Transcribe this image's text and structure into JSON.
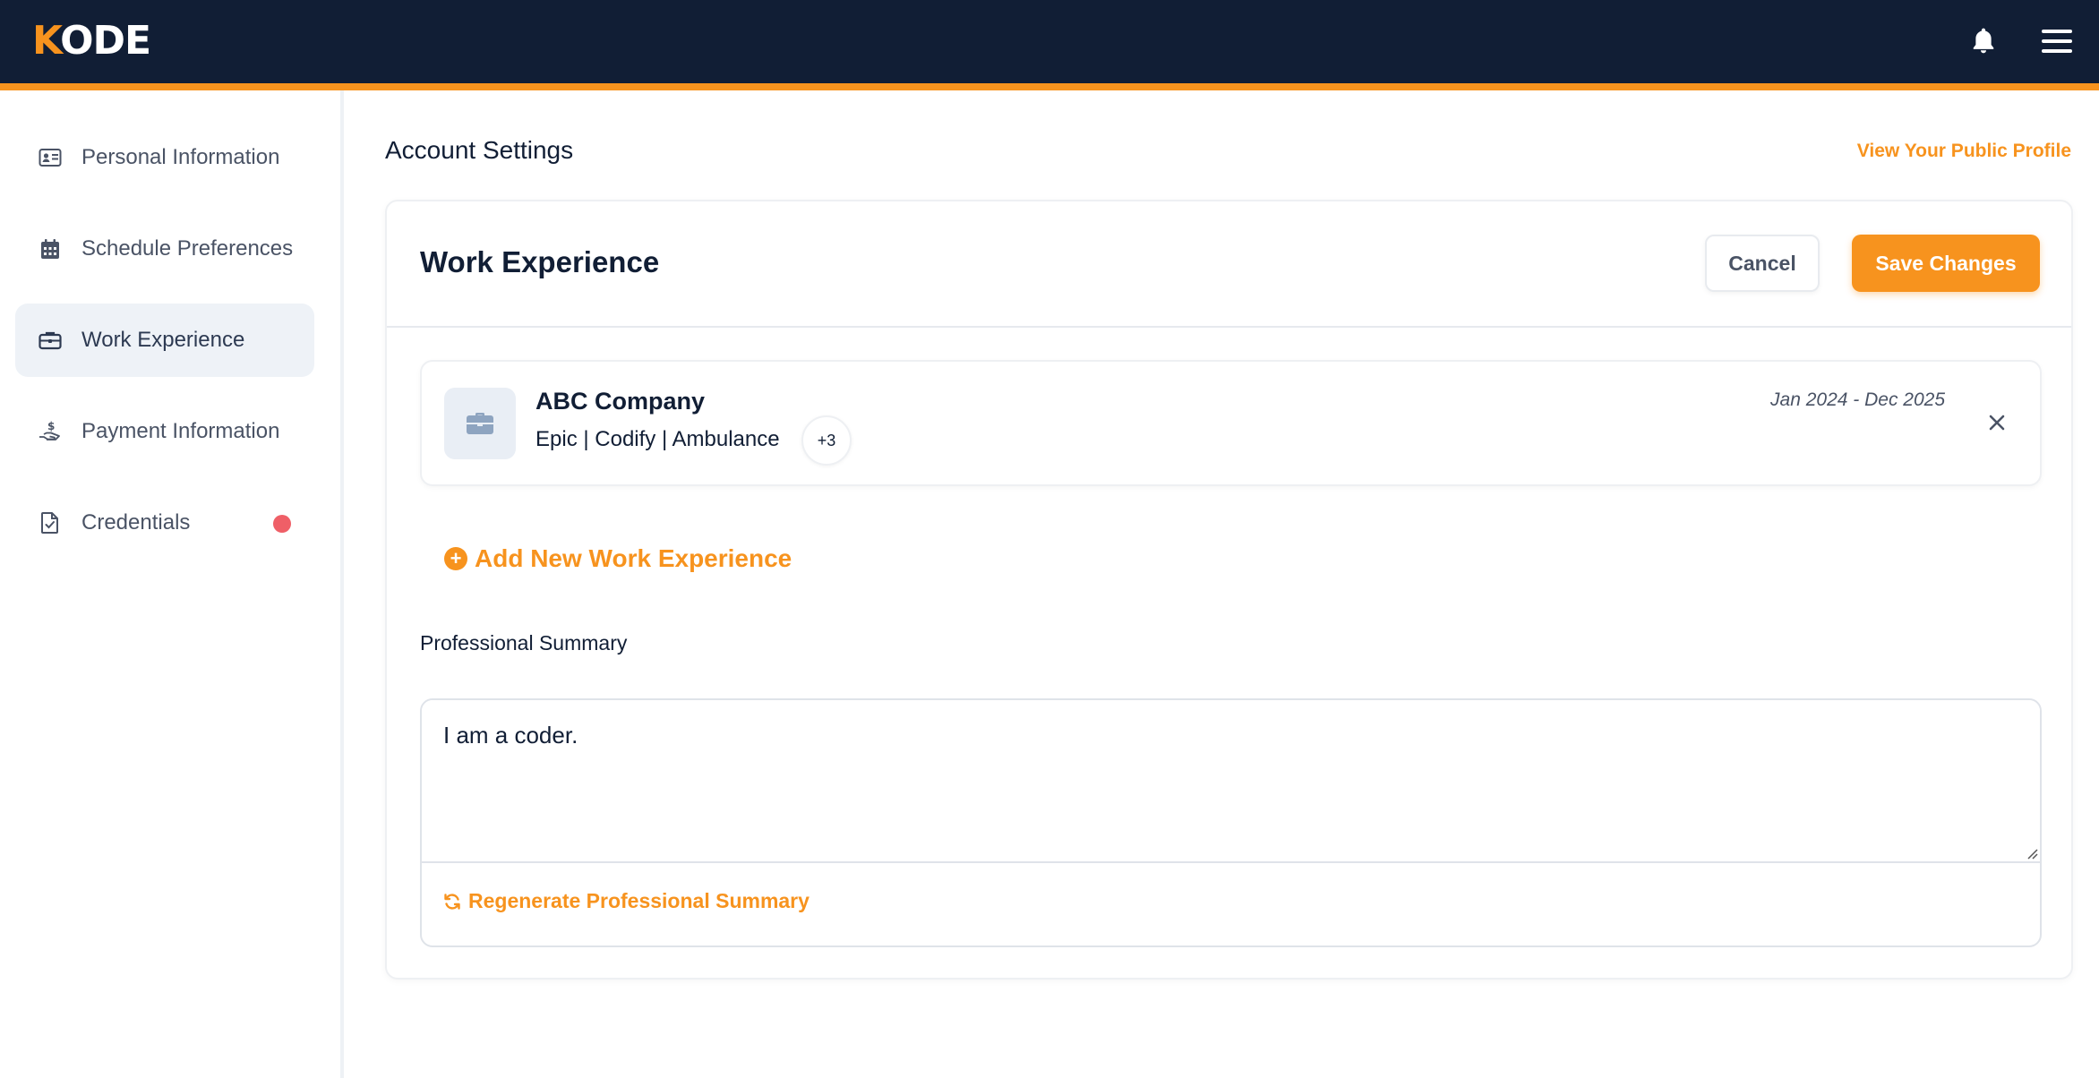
{
  "header": {
    "logo_first": "K",
    "logo_rest": "ODE",
    "bell_icon": "bell-icon",
    "menu_icon": "hamburger-menu-icon"
  },
  "sidebar": {
    "items": [
      {
        "label": "Personal Information",
        "icon": "id-card-icon",
        "active": false
      },
      {
        "label": "Schedule Preferences",
        "icon": "calendar-icon",
        "active": false
      },
      {
        "label": "Work Experience",
        "icon": "briefcase-icon",
        "active": true
      },
      {
        "label": "Payment Information",
        "icon": "hand-dollar-icon",
        "active": false
      },
      {
        "label": "Credentials",
        "icon": "file-check-icon",
        "active": false,
        "alert": true
      }
    ]
  },
  "main": {
    "title": "Account Settings",
    "public_profile_link": "View Your Public Profile"
  },
  "card": {
    "title": "Work Experience",
    "cancel_label": "Cancel",
    "save_label": "Save Changes",
    "experience": {
      "company": "ABC Company",
      "skills": "Epic | Codify | Ambulance",
      "more_count": "+3",
      "dates": "Jan 2024 - Dec 2025"
    },
    "add_label": "Add New Work Experience",
    "summary_label": "Professional Summary",
    "summary_value": "I am a coder.",
    "regenerate_label": "Regenerate Professional Summary"
  },
  "colors": {
    "navy": "#111e35",
    "accent": "#f7931e",
    "alert": "#ef5f67"
  }
}
